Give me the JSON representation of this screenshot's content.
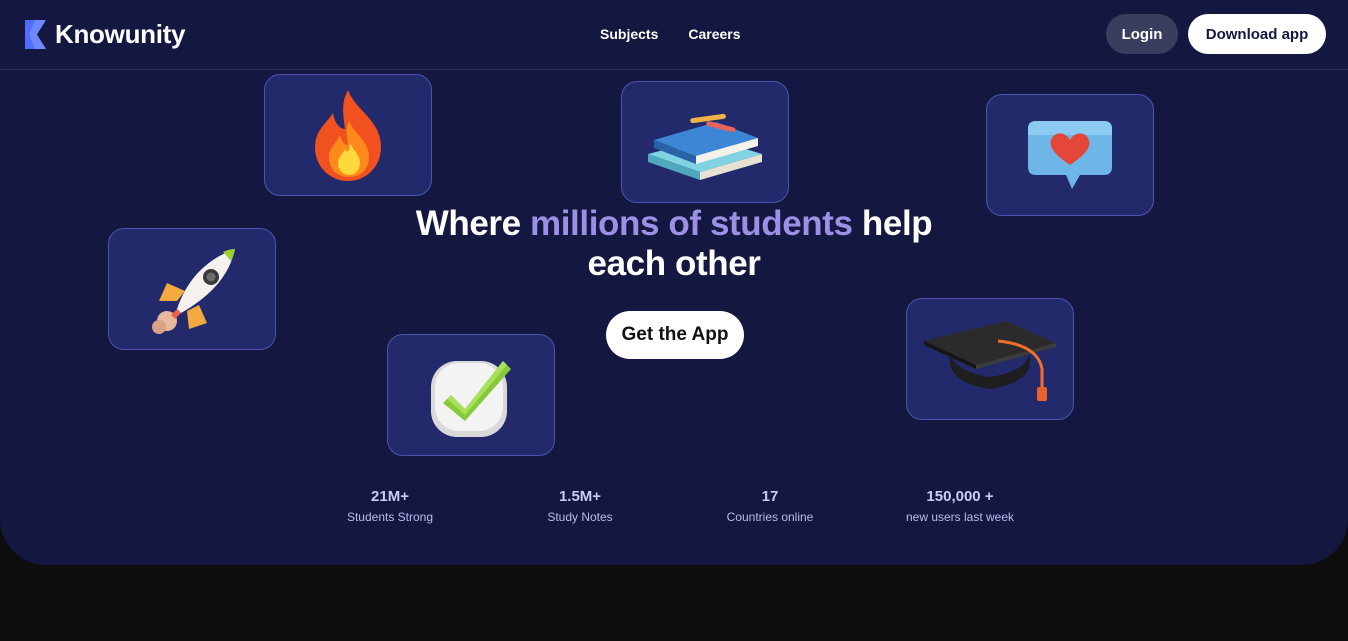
{
  "nav": {
    "brand": "Knowunity",
    "links": [
      {
        "label": "Subjects"
      },
      {
        "label": "Careers"
      }
    ],
    "login_label": "Login",
    "download_label": "Download app"
  },
  "hero": {
    "headline_pre": "Where ",
    "headline_accent": "millions of students",
    "headline_post": " help each other",
    "cta_label": "Get the App",
    "icons": [
      "fire-icon",
      "books-icon",
      "heart-chat-icon",
      "rocket-icon",
      "checkmark-icon",
      "graduation-cap-icon"
    ]
  },
  "stats": [
    {
      "value": "21M+",
      "label": "Students Strong"
    },
    {
      "value": "1.5M+",
      "label": "Study Notes"
    },
    {
      "value": "17",
      "label": "Countries online"
    },
    {
      "value": "150,000 +",
      "label": "new users last week"
    }
  ],
  "colors": {
    "background": "#14173f",
    "accent": "#9b8fe6",
    "logo_blue": "#4f6dff",
    "tile": "#222a6b"
  }
}
